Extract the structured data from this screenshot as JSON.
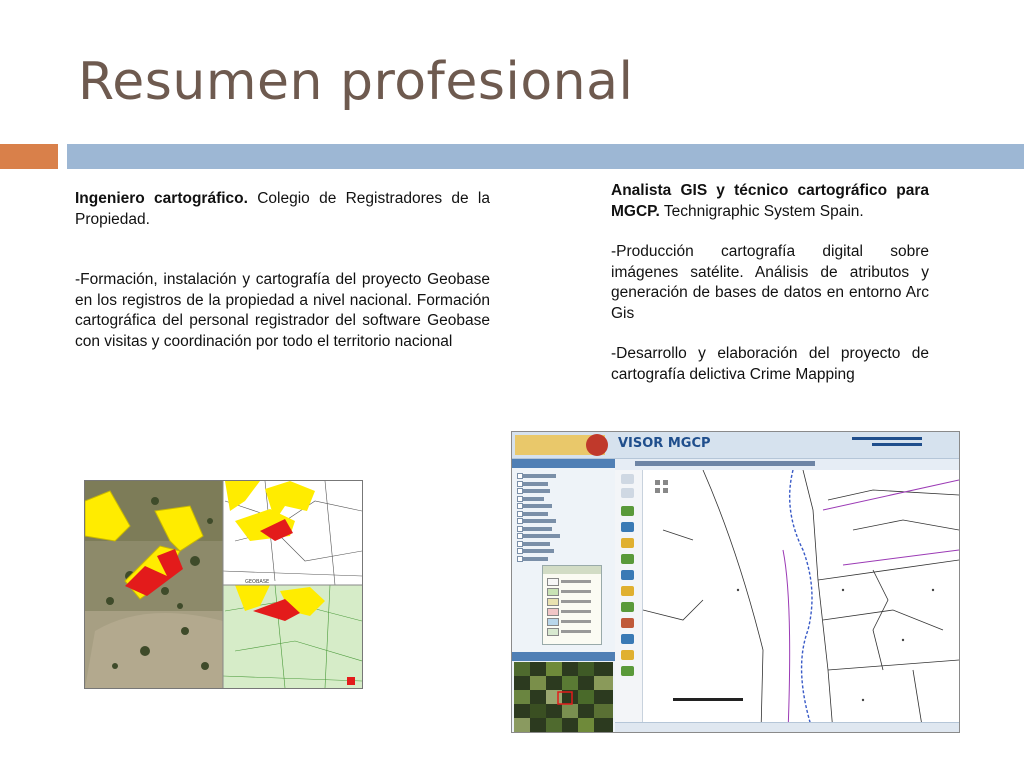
{
  "slide": {
    "title": "Resumen profesional"
  },
  "left_column": {
    "heading_bold": "Ingeniero cartográfico.",
    "heading_rest": " Colegio de Registradores de la Propiedad.",
    "description": "-Formación, instalación y cartografía del proyecto Geobase en los registros de la propiedad a nivel nacional. Formación cartográfica del personal registrador del software Geobase con visitas y coordinación por todo el territorio nacional"
  },
  "right_column": {
    "heading_bold": "Analista GIS y técnico cartográfico para MGCP.",
    "heading_rest": " Technigraphic System Spain.",
    "item1": "-Producción cartografía digital sobre imágenes satélite. Análisis de atributos y generación de bases de datos en entorno Arc Gis",
    "item2": "-Desarrollo y elaboración del proyecto de cartografía delictiva  Crime Mapping"
  },
  "visor_screenshot": {
    "app_title": "VISOR MGCP"
  },
  "colors": {
    "title": "#6e5a4f",
    "accent_orange": "#d9804a",
    "accent_blue": "#9db7d4",
    "parcel_yellow": "#ffec00",
    "parcel_red": "#e31b1b"
  }
}
